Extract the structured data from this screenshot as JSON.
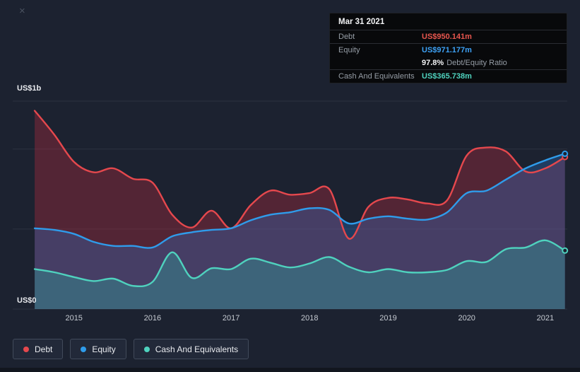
{
  "page": {
    "background": "#1c2230"
  },
  "close_icon": "×",
  "tooltip": {
    "date": "Mar 31 2021",
    "debt_label": "Debt",
    "debt_value": "US$950.141m",
    "debt_color": "#e8564e",
    "equity_label": "Equity",
    "equity_value": "US$971.177m",
    "equity_color": "#3da1f5",
    "ratio_value": "97.8%",
    "ratio_label": "Debt/Equity Ratio",
    "cash_label": "Cash And Equivalents",
    "cash_value": "US$365.738m",
    "cash_color": "#4fd2be"
  },
  "legend": {
    "items": [
      {
        "label": "Debt",
        "color": "#e5484d"
      },
      {
        "label": "Equity",
        "color": "#2f9ceb"
      },
      {
        "label": "Cash And Equivalents",
        "color": "#4fd2be"
      }
    ]
  },
  "chart_data": {
    "type": "area",
    "title": "Debt, Equity and Cash history",
    "y_unit": "US$ millions",
    "x_unit": "year",
    "y_axis_labels": {
      "top": "US$1b",
      "bottom": "US$0"
    },
    "x_tick_labels": [
      "2015",
      "2016",
      "2017",
      "2018",
      "2019",
      "2020",
      "2021"
    ],
    "x_ticks": [
      2015,
      2016,
      2017,
      2018,
      2019,
      2020,
      2021
    ],
    "x_range": [
      2014.22,
      2021.28
    ],
    "y_scale_max_millions": 1300,
    "gridlines_millions": [
      0,
      500,
      1000
    ],
    "legend_position": "bottom-left",
    "x": [
      2014.5,
      2014.75,
      2015.0,
      2015.25,
      2015.5,
      2015.75,
      2016.0,
      2016.25,
      2016.5,
      2016.75,
      2017.0,
      2017.25,
      2017.5,
      2017.75,
      2018.0,
      2018.25,
      2018.5,
      2018.75,
      2019.0,
      2019.25,
      2019.5,
      2019.75,
      2020.0,
      2020.25,
      2020.5,
      2020.75,
      2021.0,
      2021.25
    ],
    "series": [
      {
        "name": "Debt",
        "color": "#e5484d",
        "fill": "rgba(199,44,65,0.32)",
        "values": [
          1240,
          1090,
          920,
          855,
          880,
          815,
          790,
          590,
          510,
          615,
          505,
          650,
          740,
          715,
          725,
          750,
          440,
          640,
          695,
          685,
          660,
          680,
          960,
          1010,
          985,
          860,
          880,
          950.141
        ]
      },
      {
        "name": "Equity",
        "color": "#2f9ceb",
        "fill": "rgba(41,121,213,0.30)",
        "values": [
          505,
          495,
          470,
          420,
          395,
          395,
          385,
          455,
          480,
          495,
          505,
          555,
          590,
          605,
          630,
          620,
          535,
          565,
          580,
          565,
          560,
          605,
          725,
          740,
          810,
          880,
          930,
          971.177
        ]
      },
      {
        "name": "Cash And Equivalents",
        "color": "#4fd2be",
        "fill": "rgba(44,188,171,0.30)",
        "values": [
          250,
          230,
          200,
          175,
          190,
          145,
          170,
          355,
          195,
          255,
          250,
          315,
          290,
          260,
          285,
          325,
          265,
          230,
          250,
          230,
          230,
          245,
          300,
          295,
          375,
          385,
          430,
          365.738
        ]
      }
    ]
  }
}
